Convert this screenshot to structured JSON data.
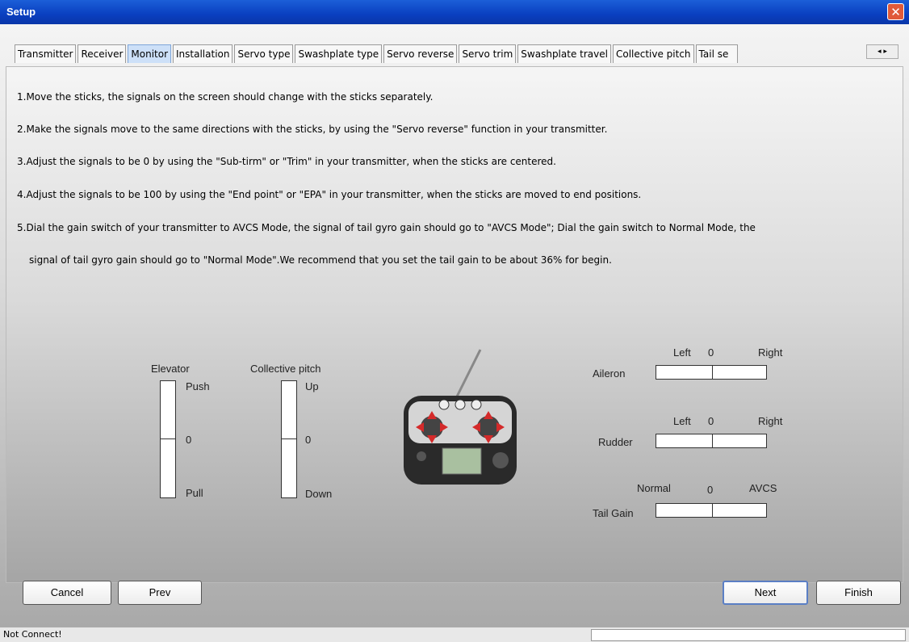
{
  "window": {
    "title": "Setup",
    "close_glyph": "✕"
  },
  "tabs": [
    {
      "label": "Transmitter"
    },
    {
      "label": "Receiver"
    },
    {
      "label": "Monitor"
    },
    {
      "label": "Installation"
    },
    {
      "label": "Servo type"
    },
    {
      "label": "Swashplate type"
    },
    {
      "label": "Servo reverse"
    },
    {
      "label": "Servo trim"
    },
    {
      "label": "Swashplate travel"
    },
    {
      "label": "Collective pitch"
    },
    {
      "label": "Tail se"
    }
  ],
  "active_tab": "Monitor",
  "tab_scroll": "◂ ▸",
  "instructions": [
    "1.Move the sticks, the signals on the screen should change with the sticks separately.",
    "2.Make the signals move to the same directions with the sticks, by using the \"Servo reverse\" function in your transmitter.",
    "3.Adjust the signals to be 0 by using the \"Sub-tirm\" or \"Trim\" in your transmitter, when the sticks are centered.",
    "4.Adjust the signals to be 100 by using the \"End point\" or \"EPA\" in your transmitter, when the sticks are moved to end positions.",
    "5.Dial the gain switch of your transmitter to AVCS Mode, the signal of tail gyro gain should go to \"AVCS Mode\";  Dial the gain switch to Normal Mode, the",
    "signal of tail gyro gain should go to \"Normal Mode\".We recommend that you set the tail gain to be about 36% for begin."
  ],
  "elevator": {
    "title": "Elevator",
    "top": "Push",
    "mid": "0",
    "bottom": "Pull"
  },
  "collective": {
    "title": "Collective pitch",
    "top": "Up",
    "mid": "0",
    "bottom": "Down"
  },
  "aileron": {
    "name": "Aileron",
    "left": "Left",
    "mid": "0",
    "right": "Right"
  },
  "rudder": {
    "name": "Rudder",
    "left": "Left",
    "mid": "0",
    "right": "Right"
  },
  "tail_gain": {
    "name": "Tail Gain",
    "left": "Normal",
    "mid": "0",
    "right": "AVCS"
  },
  "buttons": {
    "cancel": "Cancel",
    "prev": "Prev",
    "next": "Next",
    "finish": "Finish"
  },
  "status": {
    "text": "Not Connect!"
  },
  "colors": {
    "title_bar": "#0a3fc0",
    "active_tab": "#cde0f8",
    "accent_arrows": "#d42a2a"
  }
}
